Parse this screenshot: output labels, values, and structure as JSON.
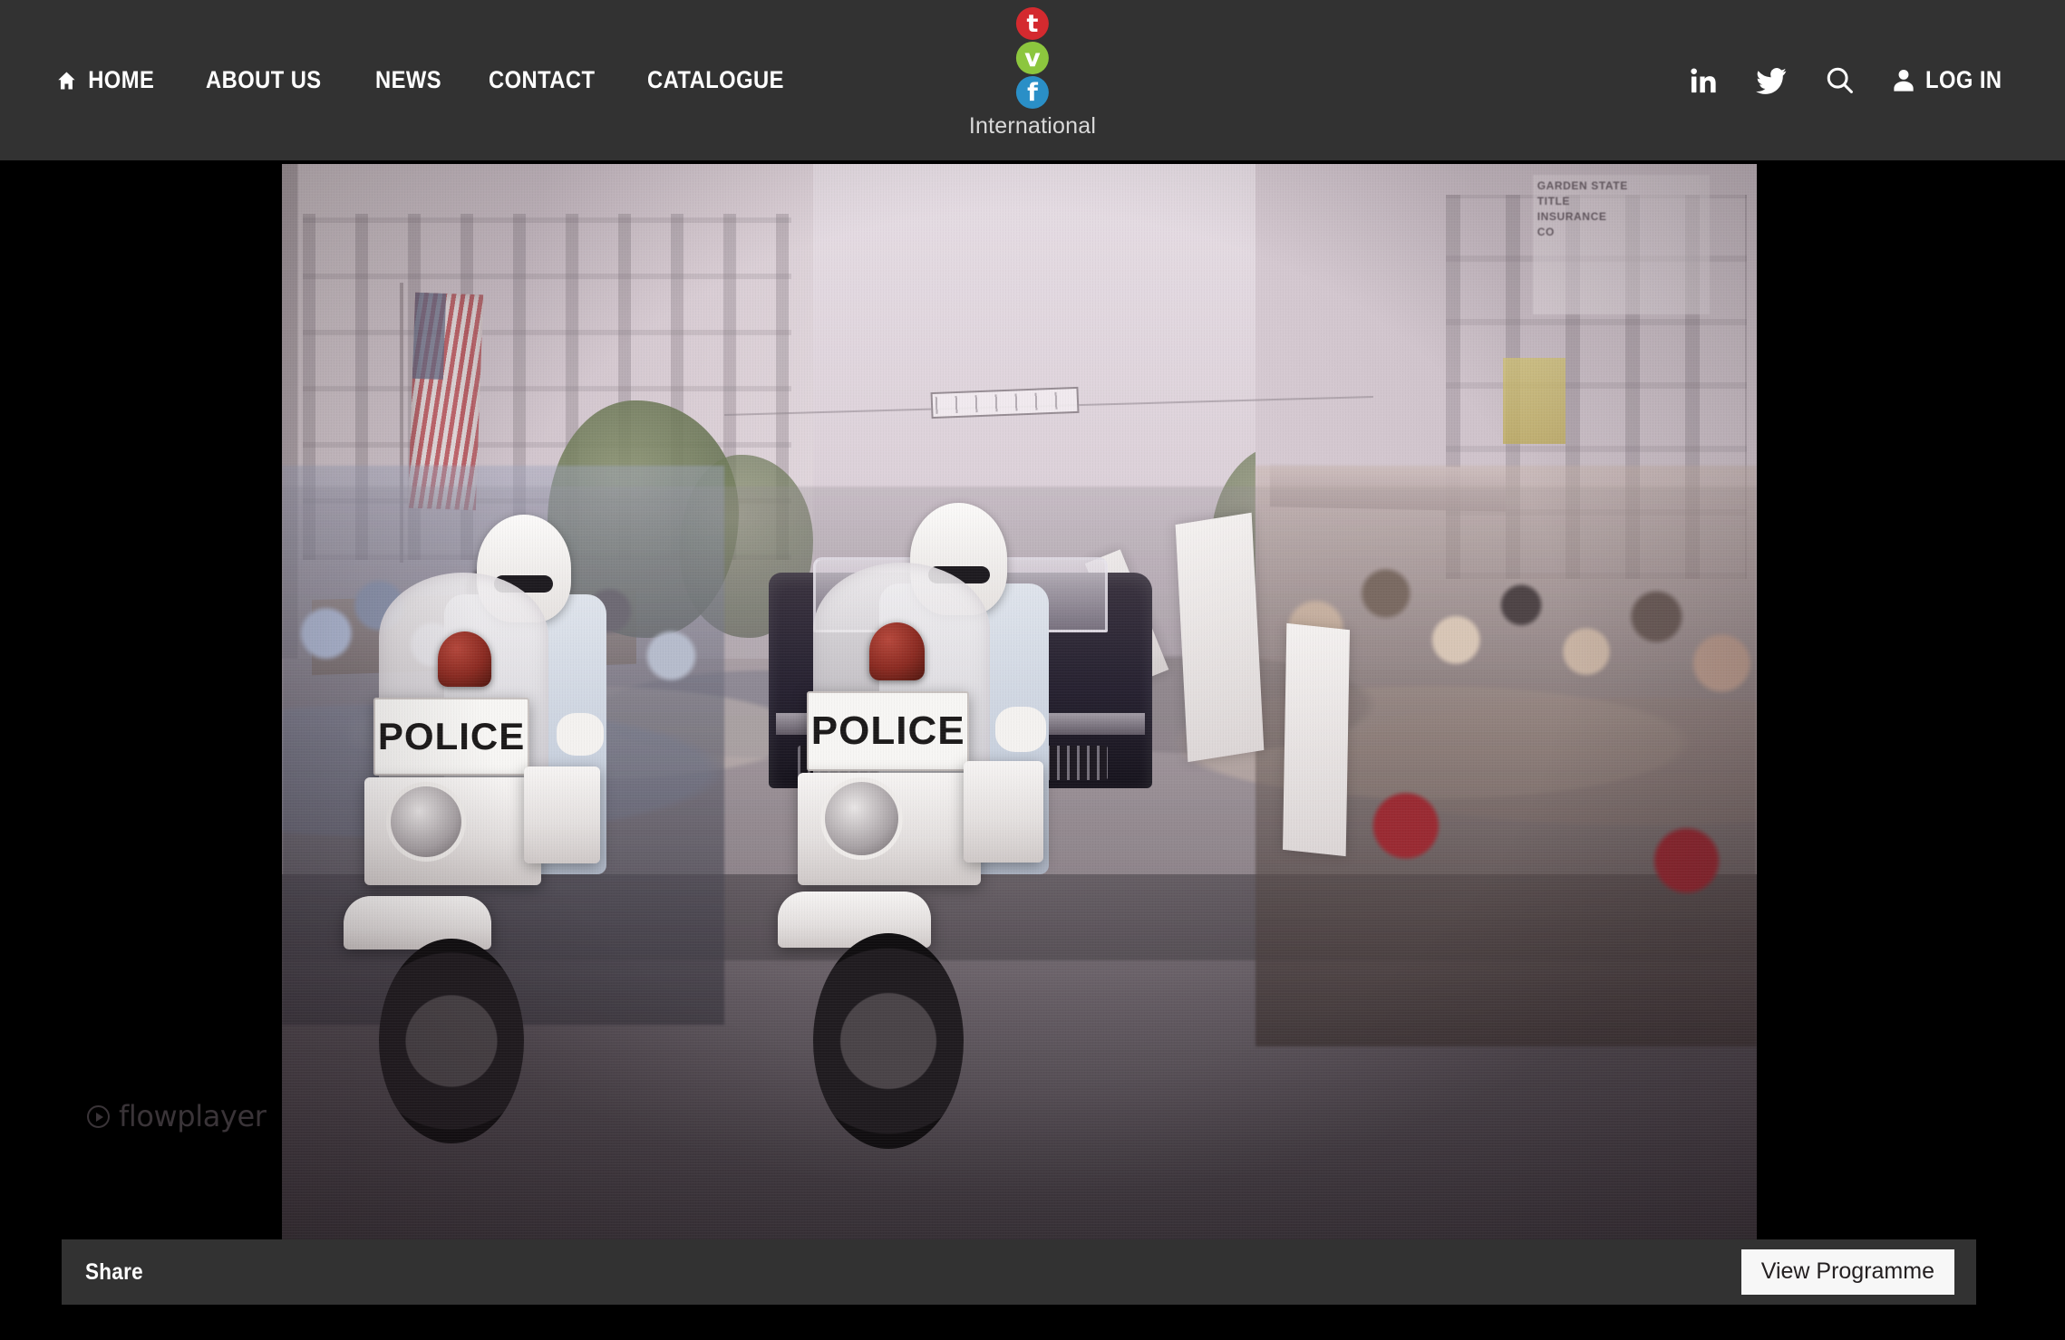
{
  "header": {
    "nav": [
      {
        "label": "HOME",
        "icon": "home-icon"
      },
      {
        "label": "ABOUT US",
        "icon": ""
      },
      {
        "label": "NEWS",
        "icon": ""
      },
      {
        "label": "CONTACT",
        "icon": ""
      },
      {
        "label": "CATALOGUE",
        "icon": ""
      }
    ],
    "logo": {
      "dots": [
        {
          "letter": "t",
          "color": "#d42a2f"
        },
        {
          "letter": "v",
          "color": "#8cc63e"
        },
        {
          "letter": "f",
          "color": "#2a8fc7"
        }
      ],
      "wordmark": "International"
    },
    "actions": {
      "linkedin_icon": "linkedin-icon",
      "twitter_icon": "twitter-icon",
      "search_icon": "search-icon",
      "user_icon": "user-icon",
      "login_label": "LOG IN"
    },
    "background_color": "#323232"
  },
  "player": {
    "watermark": "flowplayer",
    "play_icon": "play-circle-icon",
    "background_color": "#000000",
    "scene": {
      "description": "1960s colour archive footage of a motorcade on a crowded main street",
      "store_sign_text": "GARDEN STATE\nTITLE\nINSURANCE\nCO",
      "motorcycle_left_plate": "POLICE",
      "motorcycle_right_plate": "POLICE"
    }
  },
  "share_bar": {
    "label": "Share",
    "button_label": "View Programme",
    "background_color": "#323232",
    "button_color": "#f7f7f7"
  }
}
